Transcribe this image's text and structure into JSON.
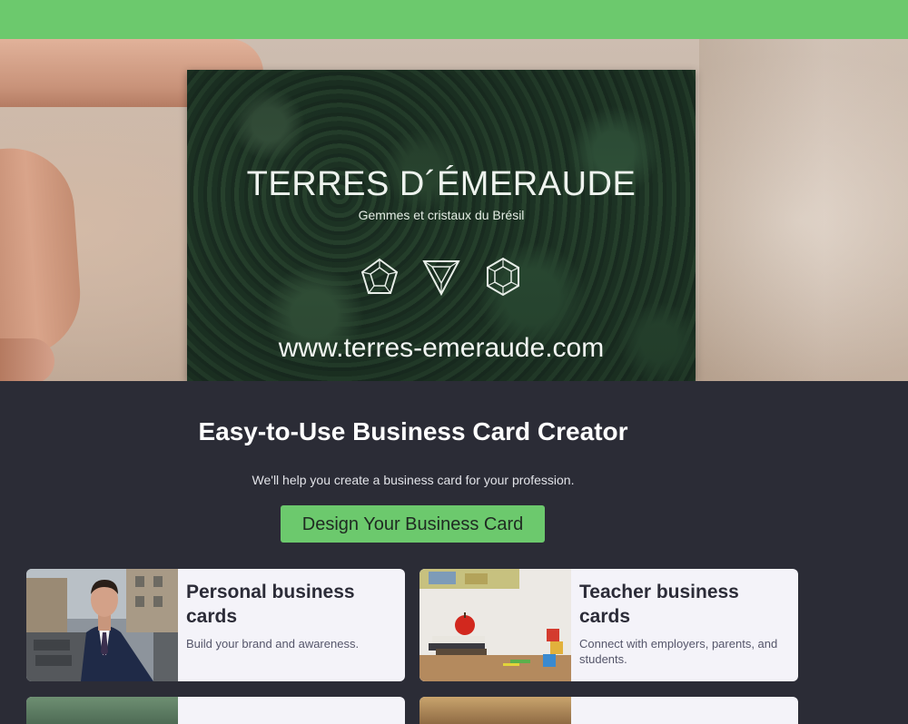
{
  "colors": {
    "accent": "#6cc96d",
    "background": "#2b2c36",
    "tile": "#f4f3f9"
  },
  "hero": {
    "card_title": "TERRES D´ÉMERAUDE",
    "card_subtitle": "Gemmes et cristaux du Brésil",
    "card_url": "www.terres-emeraude.com",
    "gem_icons": [
      "pentagon-gem-icon",
      "triangle-gem-icon",
      "hexagon-gem-icon"
    ]
  },
  "main": {
    "headline": "Easy-to-Use Business Card Creator",
    "subhead": "We'll help you create a business card for your profession.",
    "cta_label": "Design Your Business Card"
  },
  "categories": [
    {
      "title": "Personal business cards",
      "description": "Build your brand and awareness."
    },
    {
      "title": "Teacher business cards",
      "description": "Connect with employers, parents, and students."
    }
  ]
}
